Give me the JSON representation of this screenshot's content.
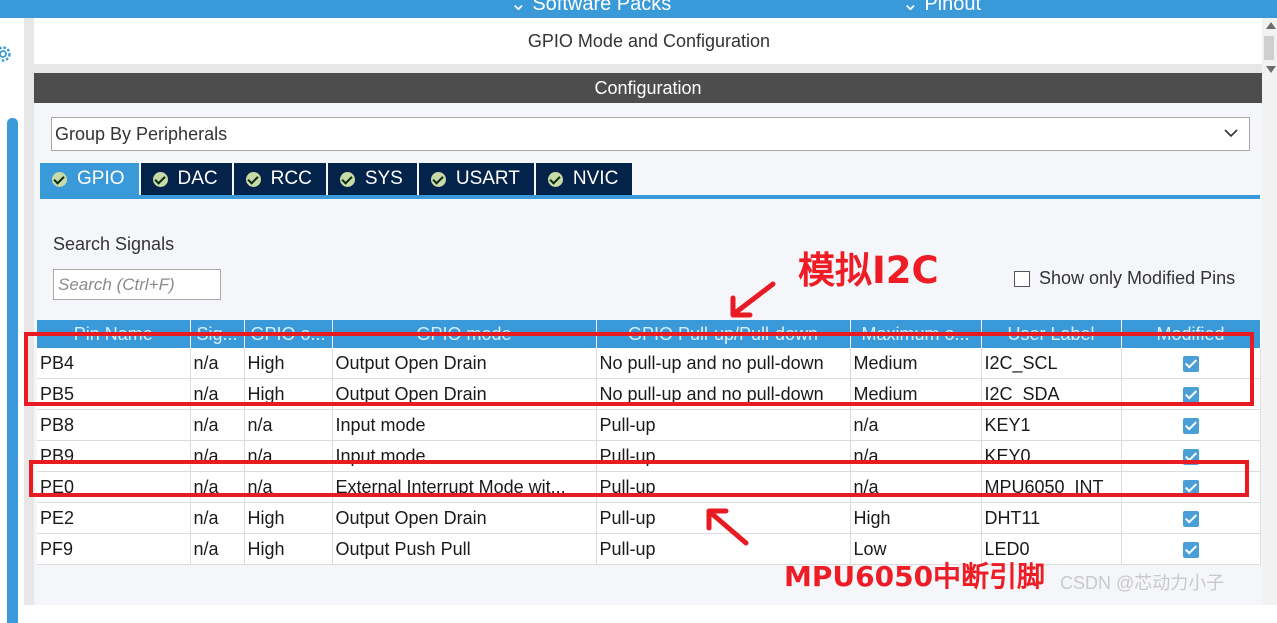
{
  "topbar": {
    "nav1": "⌄ Software Packs",
    "nav2": "⌄ Pinout"
  },
  "header": {
    "title": "GPIO Mode and Configuration"
  },
  "config": {
    "title": "Configuration"
  },
  "group_by": {
    "value": "Group By Peripherals"
  },
  "tabs": [
    {
      "label": "GPIO",
      "active": true
    },
    {
      "label": "DAC"
    },
    {
      "label": "RCC"
    },
    {
      "label": "SYS"
    },
    {
      "label": "USART"
    },
    {
      "label": "NVIC"
    }
  ],
  "search": {
    "label": "Search Signals",
    "placeholder": "Search (Ctrl+F)"
  },
  "show_modified": {
    "label": "Show only Modified Pins",
    "checked": false
  },
  "table": {
    "headers": [
      "Pin Name",
      "Sig...",
      "GPIO o...",
      "GPIO mode",
      "GPIO Pull-up/Pull-down",
      "Maximum o...",
      "User Label",
      "Modified"
    ],
    "rows": [
      [
        "PB4",
        "n/a",
        "High",
        "Output Open Drain",
        "No pull-up and no pull-down",
        "Medium",
        "I2C_SCL"
      ],
      [
        "PB5",
        "n/a",
        "High",
        "Output Open Drain",
        "No pull-up and no pull-down",
        "Medium",
        "I2C_SDA"
      ],
      [
        "PB8",
        "n/a",
        "n/a",
        "Input mode",
        "Pull-up",
        "n/a",
        "KEY1"
      ],
      [
        "PB9",
        "n/a",
        "n/a",
        "Input mode",
        "Pull-up",
        "n/a",
        "KEY0"
      ],
      [
        "PE0",
        "n/a",
        "n/a",
        "External Interrupt Mode wit...",
        "Pull-up",
        "n/a",
        "MPU6050_INT"
      ],
      [
        "PE2",
        "n/a",
        "High",
        "Output Open Drain",
        "Pull-up",
        "High",
        "DHT11"
      ],
      [
        "PF9",
        "n/a",
        "High",
        "Output Push Pull",
        "Pull-up",
        "Low",
        "LED0"
      ]
    ]
  },
  "annotations": {
    "i2c": "模拟I2C",
    "mpu": "MPU6050中断引脚"
  },
  "watermark": "CSDN @芯动力小子",
  "colors": {
    "accent": "#3a9ad9",
    "tab_dark": "#03234b",
    "highlight": "#e81b23",
    "config_bar": "#4d4d4d"
  }
}
